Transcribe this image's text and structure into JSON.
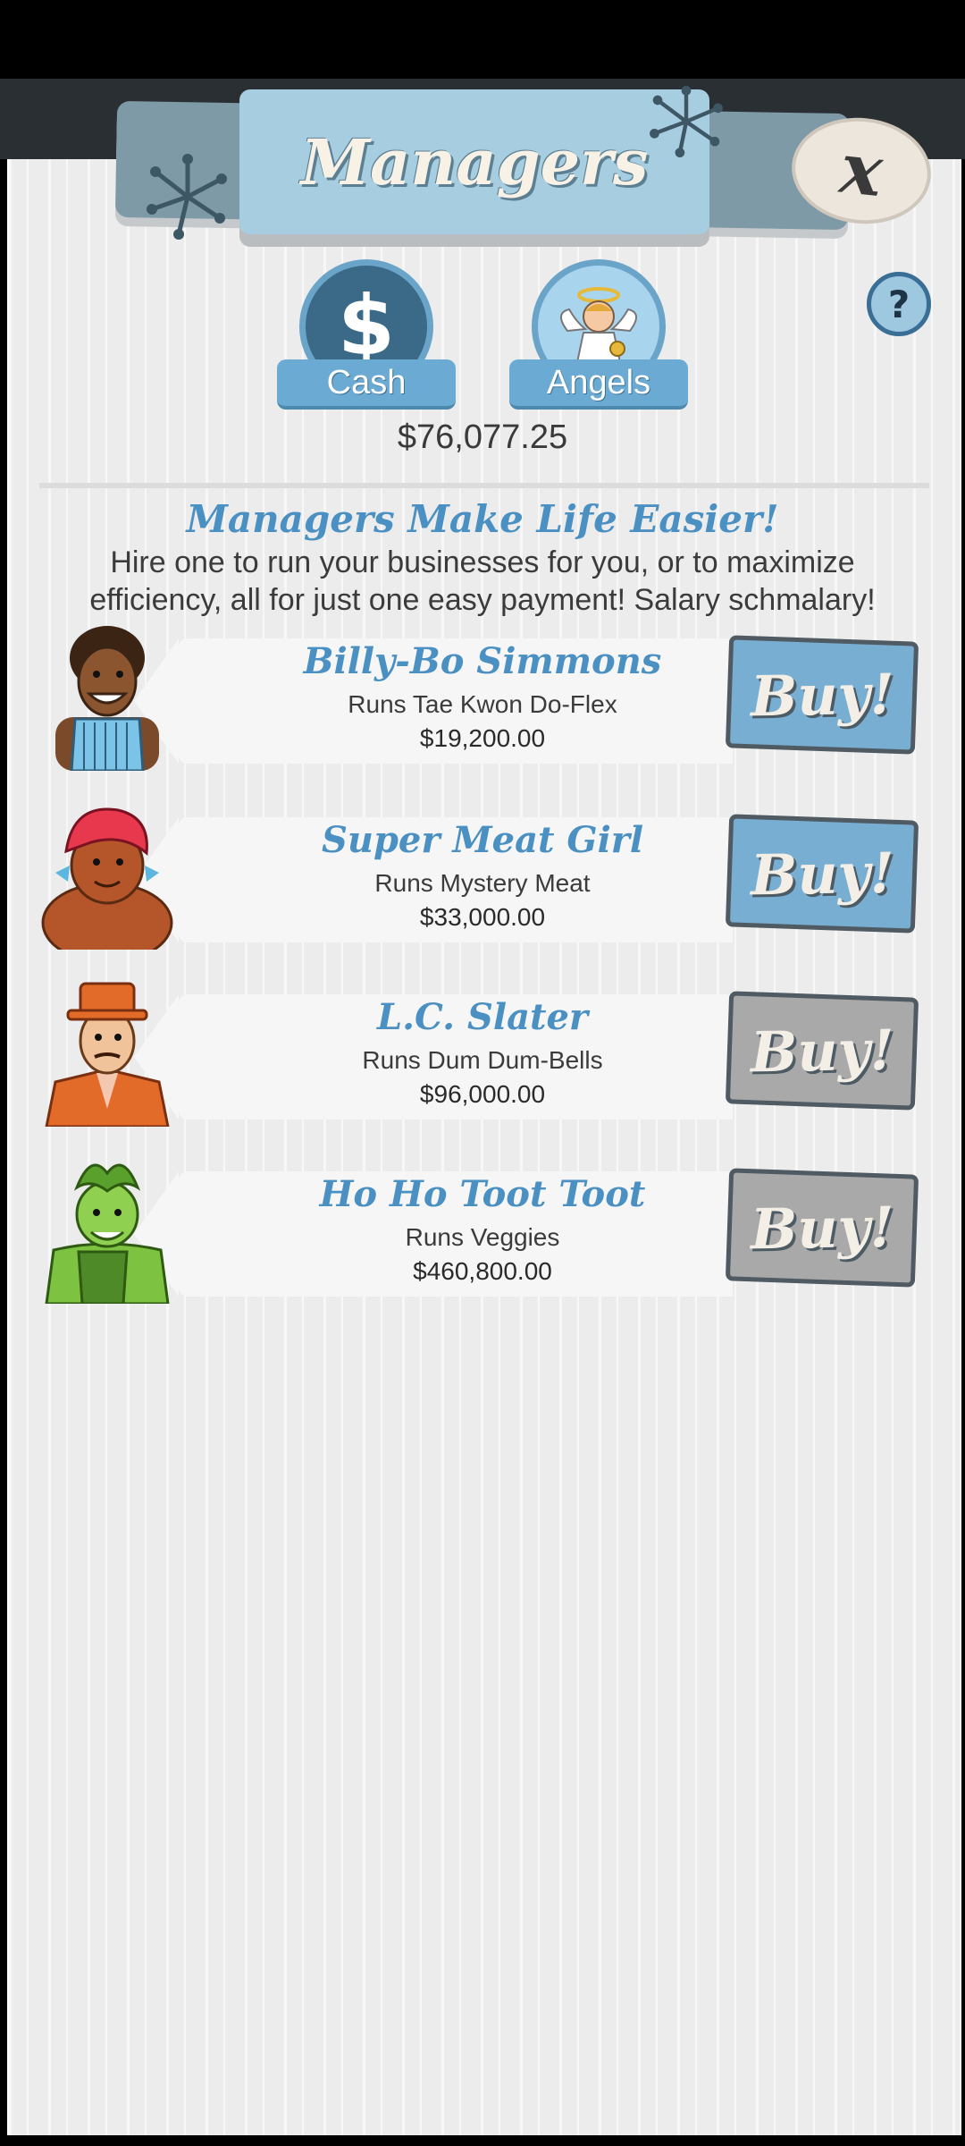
{
  "header": {
    "title": "Managers"
  },
  "currency_tabs": [
    {
      "label": "Cash",
      "icon": "dollar-icon"
    },
    {
      "label": "Angels",
      "icon": "angel-icon"
    }
  ],
  "cash_amount": "$76,077.25",
  "promo": {
    "title": "Managers Make Life Easier!",
    "text": "Hire one to run your businesses for you, or to maximize efficiency, all for just one easy payment! Salary schmalary!"
  },
  "buy_label": "Buy!",
  "managers": [
    {
      "name": "Billy-Bo Simmons",
      "runs": "Runs Tae Kwon Do-Flex",
      "cost": "$19,200.00",
      "affordable": true
    },
    {
      "name": "Super Meat Girl",
      "runs": "Runs Mystery Meat",
      "cost": "$33,000.00",
      "affordable": true
    },
    {
      "name": "L.C. Slater",
      "runs": "Runs Dum Dum-Bells",
      "cost": "$96,000.00",
      "affordable": false
    },
    {
      "name": "Ho Ho Toot Toot",
      "runs": "Runs Veggies",
      "cost": "$460,800.00",
      "affordable": false
    }
  ],
  "colors": {
    "accent_blue": "#4a90c2",
    "buy_enabled": "#78aed2",
    "buy_disabled": "#a9a9a9"
  }
}
